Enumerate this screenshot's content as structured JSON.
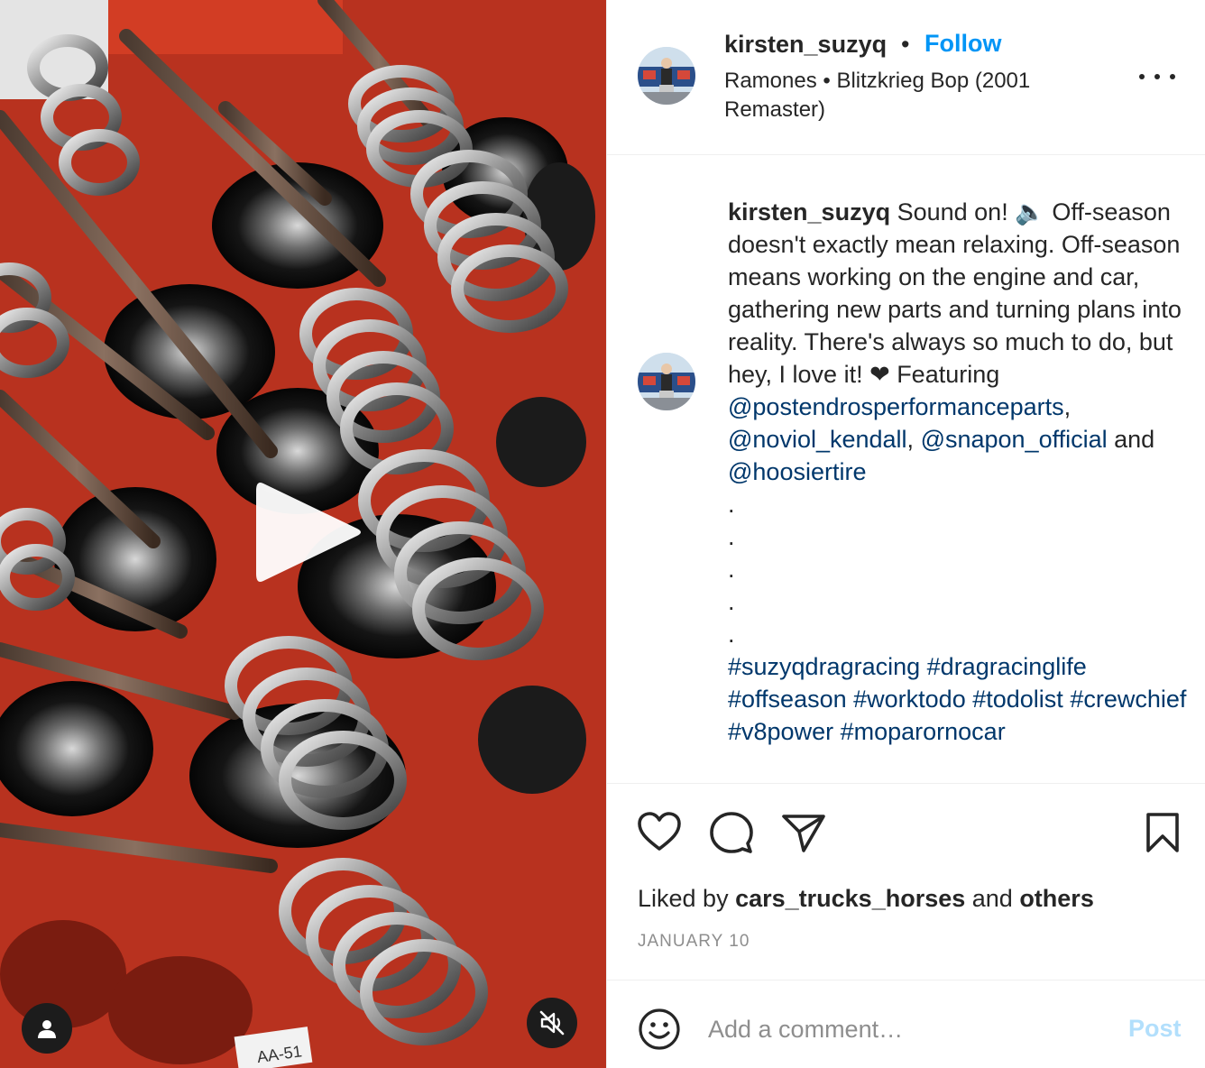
{
  "post": {
    "username": "kirsten_suzyq",
    "header_dot": "•",
    "follow_label": "Follow",
    "audio": "Ramones • Blitzkrieg Bop (2001 Remaster)",
    "media_label": "AA-51"
  },
  "caption": {
    "username": "kirsten_suzyq",
    "text_intro": "Sound on! 🔈 Off-season doesn't exactly mean relaxing. Off-season means working on the engine and car, gathering new parts and turning plans into reality. There's always so much to do, but hey, I love it! ❤ Featuring ",
    "mention_1": "@postendrosperformanceparts",
    "sep_1": ", ",
    "mention_2": "@noviol_kendall",
    "sep_2": ", ",
    "mention_3": "@snapon_official",
    "sep_3": " and ",
    "mention_4": "@hoosiertire",
    "dots": [
      ".",
      ".",
      ".",
      ".",
      "."
    ],
    "hashtags": [
      "#suzyqdragracing",
      "#dragracinglife",
      "#offseason",
      "#worktodo",
      "#todolist",
      "#crewchief",
      "#v8power",
      "#moparornocar"
    ]
  },
  "engagement": {
    "liked_by_prefix": "Liked by ",
    "liked_by_user": "cars_trucks_horses",
    "liked_by_mid": " and ",
    "liked_by_others": "others",
    "date": "JANUARY 10"
  },
  "comment_box": {
    "placeholder": "Add a comment…",
    "post_label": "Post"
  },
  "icons": {
    "play": "play-icon",
    "user_tag": "user-icon",
    "mute": "speaker-muted-icon",
    "more": "more-horizontal-icon",
    "like": "heart-icon",
    "comment": "comment-bubble-icon",
    "share": "paper-plane-icon",
    "save": "bookmark-icon",
    "emoji": "smiley-icon"
  },
  "colors": {
    "link": "#00376b",
    "follow": "#0095f6",
    "post_disabled": "#b2dffc",
    "muted_text": "#8e8e8e",
    "tray_red": "#c23a22"
  }
}
